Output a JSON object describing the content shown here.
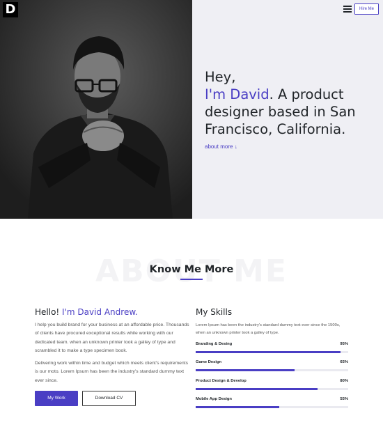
{
  "brand": {
    "logo_letter": "D"
  },
  "header": {
    "hire_label": "Hire Me",
    "menu_icon": "hamburger-icon"
  },
  "hero": {
    "greeting": "Hey,",
    "name_line": "I'm David",
    "line1_rest": ". A product",
    "line2": "designer based in San",
    "line3": "Francisco, California.",
    "about_link": "about more ↓"
  },
  "about": {
    "bg_text": "ABOUT ME",
    "title": "Know Me More",
    "hello": "Hello! ",
    "hello_name": "I'm David Andrew.",
    "para1": "I help you build brand for your business at an affordable price. Thousands of clients have procured exceptional results while working with our dedicated team. when an unknown printer took a galley of type and scrambled it to make a type specimen book.",
    "para2": "Delivering work within time and budget which meets client's requirements is our moto. Lorem Ipsum has been the industry's standard dummy text ever since.",
    "btn_work": "My Work",
    "btn_cv": "Download CV"
  },
  "skills": {
    "title": "My Skills",
    "desc": "Lorem Ipsum has been the industry's standard dummy text ever since the 1500s, when an unknown printer took a galley of type.",
    "items": [
      {
        "name": "Branding & Desing",
        "pct_label": "95%",
        "value": 95
      },
      {
        "name": "Game Design",
        "pct_label": "65%",
        "value": 65
      },
      {
        "name": "Product Design & Develop",
        "pct_label": "80%",
        "value": 80
      },
      {
        "name": "Mobile App Design",
        "pct_label": "55%",
        "value": 55
      }
    ]
  },
  "colors": {
    "accent": "#4a3ec4",
    "panel": "#efeff4",
    "dark": "#212529"
  }
}
